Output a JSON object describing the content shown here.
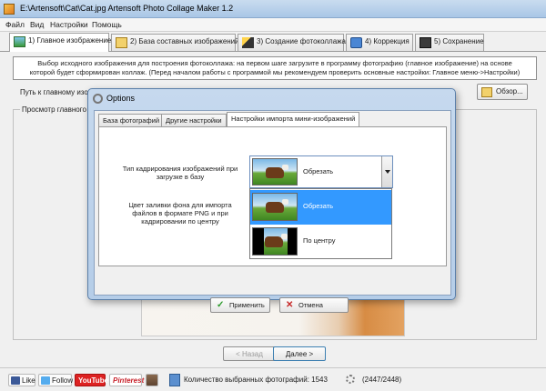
{
  "window": {
    "title": "E:\\Artensoft\\Cat\\Cat.jpg Artensoft Photo Collage Maker 1.2"
  },
  "menu": [
    "Файл",
    "Вид",
    "Настройки",
    "Помощь"
  ],
  "tabs": [
    {
      "label": "1) Главное изображение",
      "active": true
    },
    {
      "label": "2) База составных изображений",
      "active": false
    },
    {
      "label": "3) Создание фотоколлажа",
      "active": false
    },
    {
      "label": "4) Коррекция",
      "active": false
    },
    {
      "label": "5) Сохранение",
      "active": false
    }
  ],
  "info": {
    "line1": "Выбор исходного изображения для построения фотоколлажа: на первом шаге загрузите в программу фотографию (главное изображение) на основе",
    "line2": "которой будет сформирован коллаж. (Перед началом работы с программой мы рекомендуем проверить основные настройки: Главное меню->Настройки)"
  },
  "path_label": "Путь к главному изо",
  "browse_label": "Обзор...",
  "preview_label": "Просмотр главного",
  "nav": {
    "prev": "< Назад",
    "next": "Далее >"
  },
  "status": {
    "like": "Like",
    "follow": "Follow",
    "youtube": "YouTube",
    "pinterest": "Pinterest",
    "selected_count": "Количество выбранных фотографий: 1543",
    "progress": "(2447/2448)"
  },
  "dialog": {
    "title": "Options",
    "tabs": [
      {
        "label": "База фотографий",
        "active": false
      },
      {
        "label": "Другие настройки",
        "active": false
      },
      {
        "label": "Настройки импорта мини-изображений",
        "active": true
      }
    ],
    "crop_label_1": "Тип кадрирования изображений при",
    "crop_label_2": "загрузке в базу",
    "crop_value": "Обрезать",
    "fill_label_1": "Цвет заливки фона для импорта",
    "fill_label_2": "файлов в формате PNG и при",
    "fill_label_3": "кадрировании по центру",
    "options": [
      {
        "label": "Обрезать",
        "selected": true
      },
      {
        "label": "По центру",
        "selected": false
      }
    ],
    "apply": "Применить",
    "cancel": "Отмена"
  }
}
